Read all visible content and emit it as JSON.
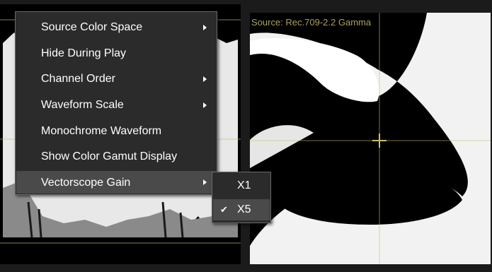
{
  "waveform": {
    "source_label": "Source: Rec.709-2.2 Gamma"
  },
  "vectorscope": {
    "source_label": "Source: Rec.709-2.2 Gamma"
  },
  "context_menu": {
    "items": [
      {
        "label": "Source Color Space",
        "has_submenu": true
      },
      {
        "label": "Hide During Play",
        "has_submenu": false
      },
      {
        "label": "Channel Order",
        "has_submenu": true
      },
      {
        "label": "Waveform Scale",
        "has_submenu": true
      },
      {
        "label": "Monochrome Waveform",
        "has_submenu": false
      },
      {
        "label": "Show Color Gamut Display",
        "has_submenu": false
      },
      {
        "label": "Vectorscope Gain",
        "has_submenu": true,
        "highlighted": true
      }
    ]
  },
  "gain_submenu": {
    "items": [
      {
        "label": "X1",
        "checked": false
      },
      {
        "label": "X5",
        "checked": true,
        "check_icon": "check-icon"
      }
    ]
  },
  "colors": {
    "menu_bg": "#2b2b2b",
    "menu_border": "#6a6a6a",
    "highlight": "#4a4a4a",
    "scope_bg": "#000000",
    "graticule": "#c8be6e"
  }
}
